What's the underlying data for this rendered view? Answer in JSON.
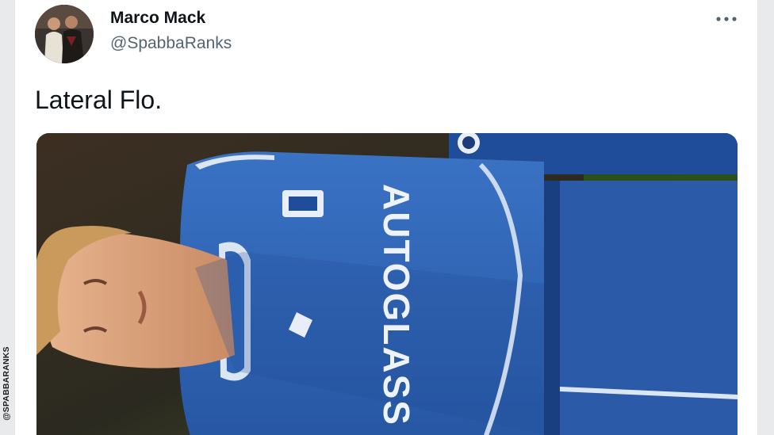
{
  "tweet": {
    "author_name": "Marco Mack",
    "author_handle": "@SpabbaRanks",
    "text": "Lateral Flo."
  },
  "media": {
    "shirt_sponsor": "AUTOGLASS",
    "colors": {
      "kit_blue": "#2f64b4",
      "kit_trim": "#dbe6f5",
      "skin": "#d9a07a",
      "hair": "#c99a5c",
      "background_dark": "#2b2a20"
    }
  },
  "watermark": "@SPABBARANKS",
  "icons": {
    "more": "more-horizontal-icon"
  }
}
